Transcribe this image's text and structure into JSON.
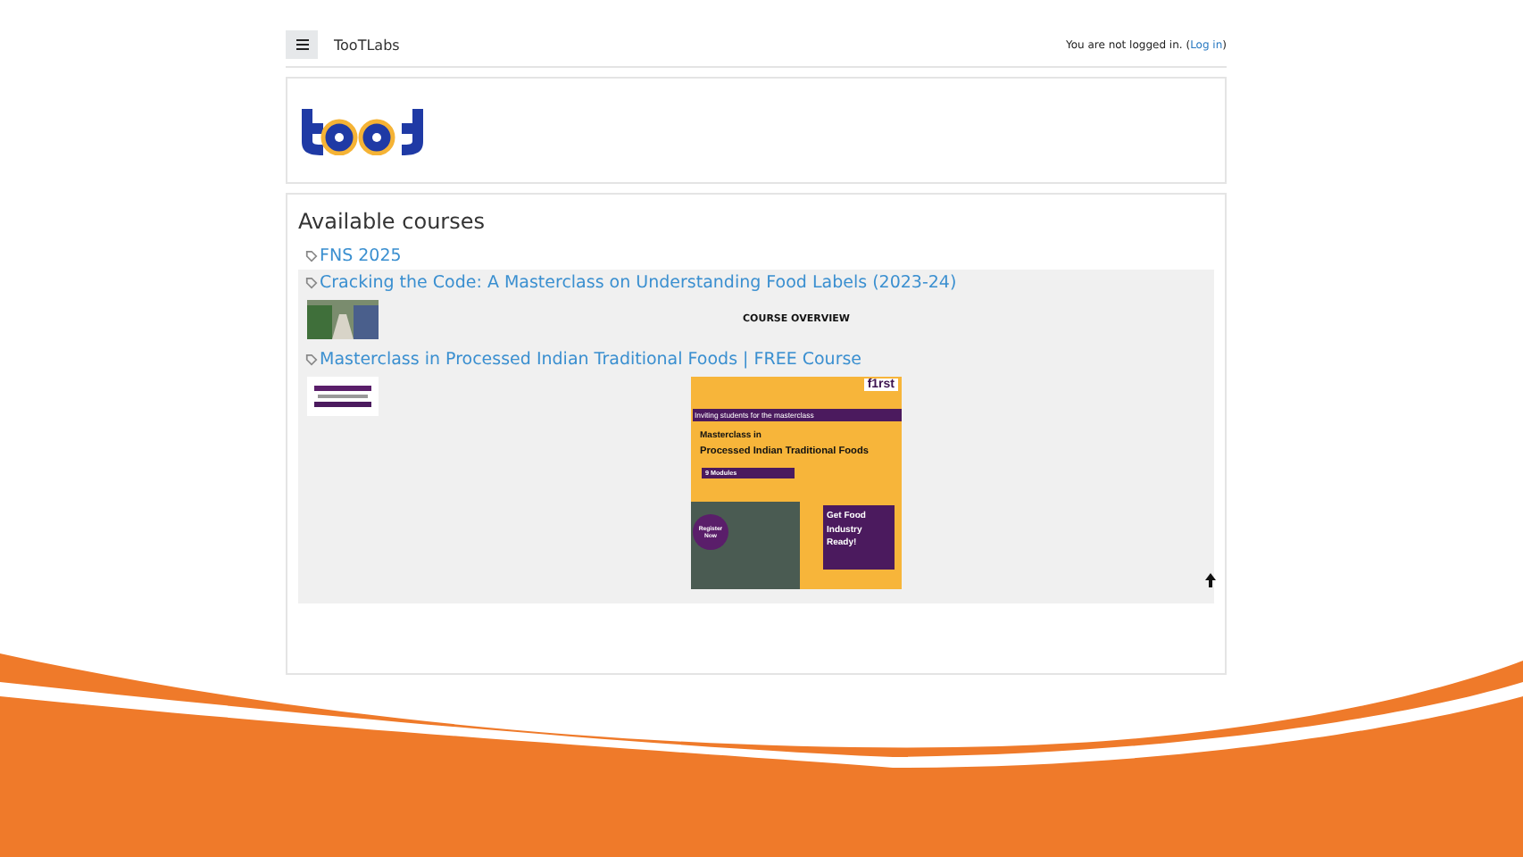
{
  "navbar": {
    "site_name": "TooTLabs",
    "login_text": "You are not logged in. (",
    "login_link": "Log in",
    "login_close": ")"
  },
  "courses": {
    "heading": "Available courses",
    "items": [
      {
        "title": "FNS 2025",
        "kind": "plain"
      },
      {
        "title": "Cracking the Code: A Masterclass on Understanding Food Labels (2023-24)",
        "kind": "overview",
        "summary": "COURSE OVERVIEW"
      },
      {
        "title": "Masterclass in Processed Indian Traditional Foods | FREE Course",
        "kind": "poster",
        "poster": {
          "brand": "f1rst",
          "banner": "Inviting students for the masterclass",
          "title_small": "Masterclass",
          "title_in": "in",
          "title": "Processed Indian Traditional Foods",
          "modules": "9 Modules",
          "register": "Register Now",
          "cta": "Get Food Industry Ready!"
        }
      }
    ]
  }
}
